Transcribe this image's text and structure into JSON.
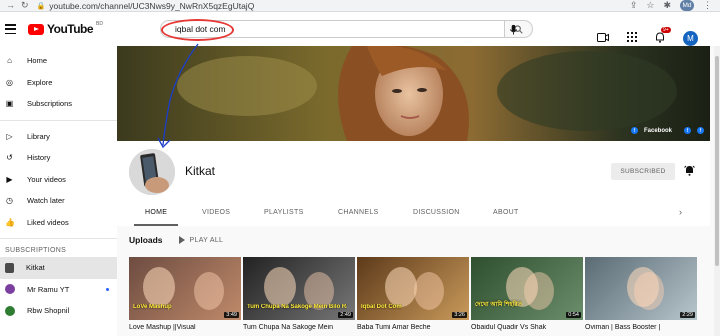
{
  "browser": {
    "url": "youtube.com/channel/UC3Nws9y_NwRnX5qzEgUtajQ",
    "account": "Md"
  },
  "header": {
    "logo_text": "YouTube",
    "country_code": "BD",
    "search_value": "iqbal dot com",
    "notification_count": "9+",
    "avatar_letter": "M"
  },
  "sidebar": {
    "items": [
      {
        "label": "Home",
        "icon": "home-icon"
      },
      {
        "label": "Explore",
        "icon": "compass-icon"
      },
      {
        "label": "Subscriptions",
        "icon": "subscriptions-icon"
      },
      {
        "label": "Library",
        "icon": "library-icon"
      },
      {
        "label": "History",
        "icon": "history-icon"
      },
      {
        "label": "Your videos",
        "icon": "play-icon"
      },
      {
        "label": "Watch later",
        "icon": "clock-icon"
      },
      {
        "label": "Liked videos",
        "icon": "thumbs-up-icon"
      }
    ],
    "subscriptions_heading": "SUBSCRIPTIONS",
    "subscriptions": [
      {
        "label": "Kitkat",
        "active": true,
        "color": "#4a4a4a"
      },
      {
        "label": "Mr Ramu YT",
        "new": true,
        "color": "#7b3fa0"
      },
      {
        "label": "Rbw Shopnil",
        "color": "#2e7d32"
      }
    ]
  },
  "banner": {
    "link_label": "Facebook"
  },
  "channel": {
    "name": "Kitkat",
    "subscribed_label": "SUBSCRIBED",
    "tabs": [
      "HOME",
      "VIDEOS",
      "PLAYLISTS",
      "CHANNELS",
      "DISCUSSION",
      "ABOUT"
    ]
  },
  "uploads": {
    "title": "Uploads",
    "play_all": "PLAY ALL",
    "videos": [
      {
        "title": "Love Mashup ||Visual",
        "duration": "3:49",
        "overlay": "LoVe Mashup",
        "bg": [
          "#6d4c41",
          "#c08a6a"
        ]
      },
      {
        "title": "Tum Chupa Na Sakoge Mein",
        "duration": "2:49",
        "overlay": "Tum Chupa Na Sakoge Mein Bilo Raat",
        "bg": [
          "#222",
          "#777"
        ]
      },
      {
        "title": "Baba Tumi Amar Beche",
        "duration": "3:26",
        "overlay": "Iqbal Dot Com",
        "bg": [
          "#5d3a1a",
          "#c99a5b"
        ]
      },
      {
        "title": "Obaidul Quadir Vs Shak",
        "duration": "0:54",
        "overlay": "দেখো আমি শিহরিত",
        "bg": [
          "#2f4f2f",
          "#6b8e6b"
        ]
      },
      {
        "title": "Oviman | Bass Booster |",
        "duration": "2:29",
        "overlay": "",
        "bg": [
          "#5a6b74",
          "#b7c5cc"
        ]
      }
    ]
  }
}
